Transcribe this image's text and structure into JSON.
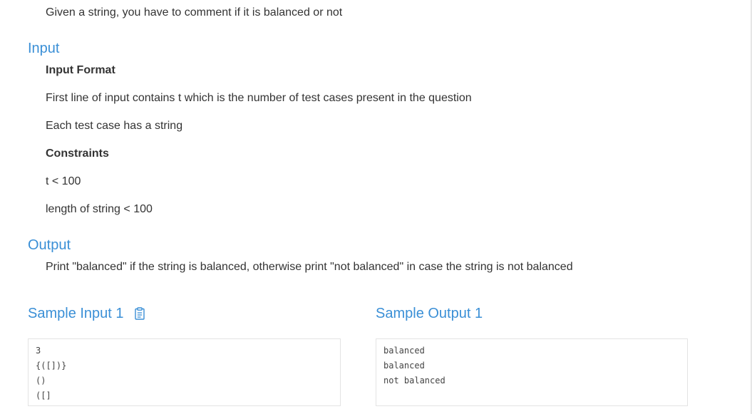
{
  "description": "Given a string, you have to comment if it is balanced or not",
  "input_section": {
    "heading": "Input",
    "format_title": "Input Format",
    "format_lines": [
      "First line of input contains t which is the number of test cases present in the question",
      "Each test case has a string"
    ],
    "constraints_title": "Constraints",
    "constraints": [
      "t < 100",
      "length of string < 100"
    ]
  },
  "output_section": {
    "heading": "Output",
    "text": "Print \"balanced\" if the string is balanced, otherwise print \"not balanced\" in case the string is not balanced"
  },
  "samples": {
    "input_heading": "Sample Input 1",
    "output_heading": "Sample Output 1",
    "copy_icon": "clipboard-icon",
    "input_lines": [
      "3",
      "{([])}",
      "()",
      "([]"
    ],
    "output_lines": [
      "balanced",
      "balanced",
      "not balanced"
    ]
  },
  "colors": {
    "heading": "#3a8fd6",
    "text": "#333333",
    "box_border": "#e3e3e3"
  }
}
